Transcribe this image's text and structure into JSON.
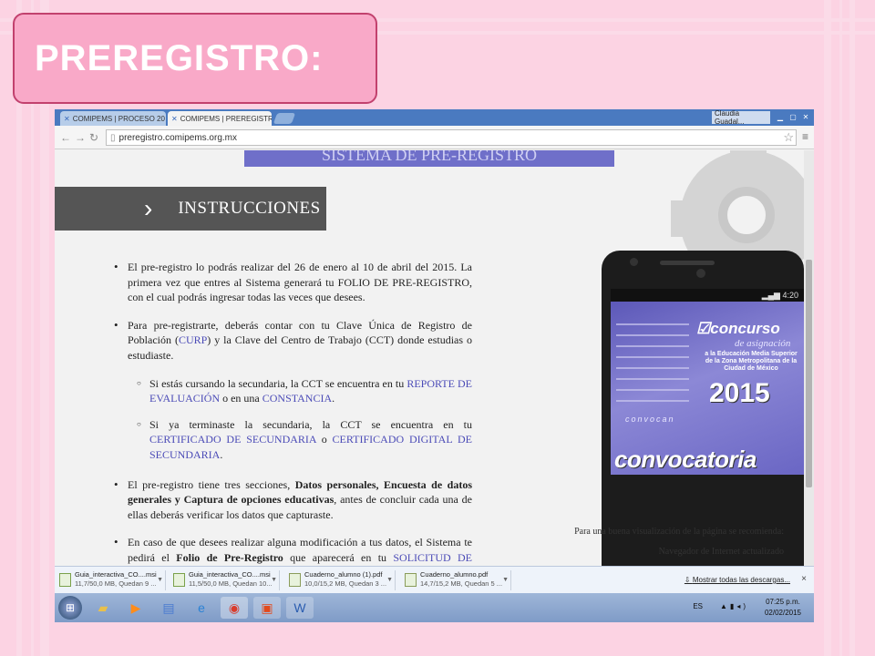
{
  "slide": {
    "title": "PREREGISTRO:"
  },
  "browser": {
    "tabs": [
      {
        "label": "COMIPEMS | PROCESO 20"
      },
      {
        "label": "COMIPEMS | PREREGISTR"
      }
    ],
    "user": "Claudia Guadal...",
    "url": "preregistro.comipems.org.mx"
  },
  "page": {
    "banner": "SISTEMA DE PRE-REGISTRO",
    "section": "INSTRUCCIONES",
    "b1": "El pre-registro lo podrás realizar del 26 de enero al 10 de abril del 2015. La primera vez que entres al Sistema generará tu FOLIO DE PRE-REGISTRO, con el cual podrás ingresar todas las veces que desees.",
    "b2a": "Para pre-registrarte, deberás contar con tu Clave Única de Registro de Población (",
    "b2link": "CURP",
    "b2b": ") y la Clave del Centro de Trabajo (CCT) donde estudias o estudiaste.",
    "s1a": "Si estás cursando la secundaria, la CCT se encuentra en tu ",
    "s1link1": "REPORTE DE EVALUACIÓN",
    "s1b": " o en una ",
    "s1link2": "CONSTANCIA",
    "s1c": ".",
    "s2a": "Si ya terminaste la secundaria, la CCT se encuentra en tu ",
    "s2link1": "CERTIFICADO DE SECUNDARIA",
    "s2b": " o ",
    "s2link2": "CERTIFICADO DIGITAL DE SECUNDARIA",
    "s2c": ".",
    "b3a": "El pre-registro tiene tres secciones, ",
    "b3bold": "Datos personales, Encuesta de datos generales y Captura de opciones educativas",
    "b3b": ", antes de concluir cada una de ellas deberás verificar los datos que capturaste.",
    "b4a": "En caso de que desees realizar alguna modificación a tus datos, el Sistema te pedirá el ",
    "b4bold": "Folio de Pre-Registro",
    "b4b": " que aparecerá en tu ",
    "b4link": "SOLICITUD DE REGISTRO",
    "b4c": ".",
    "recom1": "Para una buena visualización de la página se recomienda:",
    "recom2": "Navegador de Internet actualizado"
  },
  "phone": {
    "time": "4:20",
    "concurso": "concurso",
    "asignacion": "de asignación",
    "subtitle": "a la Educación Media Superior de la Zona Metropolitana de la Ciudad de México",
    "year": "2015",
    "convocan": "convocan",
    "big": "convocatoria"
  },
  "downloads": {
    "items": [
      {
        "name": "Guia_interactiva_CO....msi",
        "meta": "11,7/50,0 MB, Quedan 9 ..."
      },
      {
        "name": "Guia_interactiva_CO....msi",
        "meta": "11,5/50,0 MB, Quedan 10..."
      },
      {
        "name": "Cuaderno_alumno (1).pdf",
        "meta": "10,0/15,2 MB, Quedan 3 ..."
      },
      {
        "name": "Cuaderno_alumno.pdf",
        "meta": "14,7/15,2 MB, Quedan 5 ..."
      }
    ],
    "show_all": "Mostrar todas las descargas..."
  },
  "taskbar": {
    "lang": "ES",
    "time": "07:25 p.m.",
    "date": "02/02/2015"
  }
}
